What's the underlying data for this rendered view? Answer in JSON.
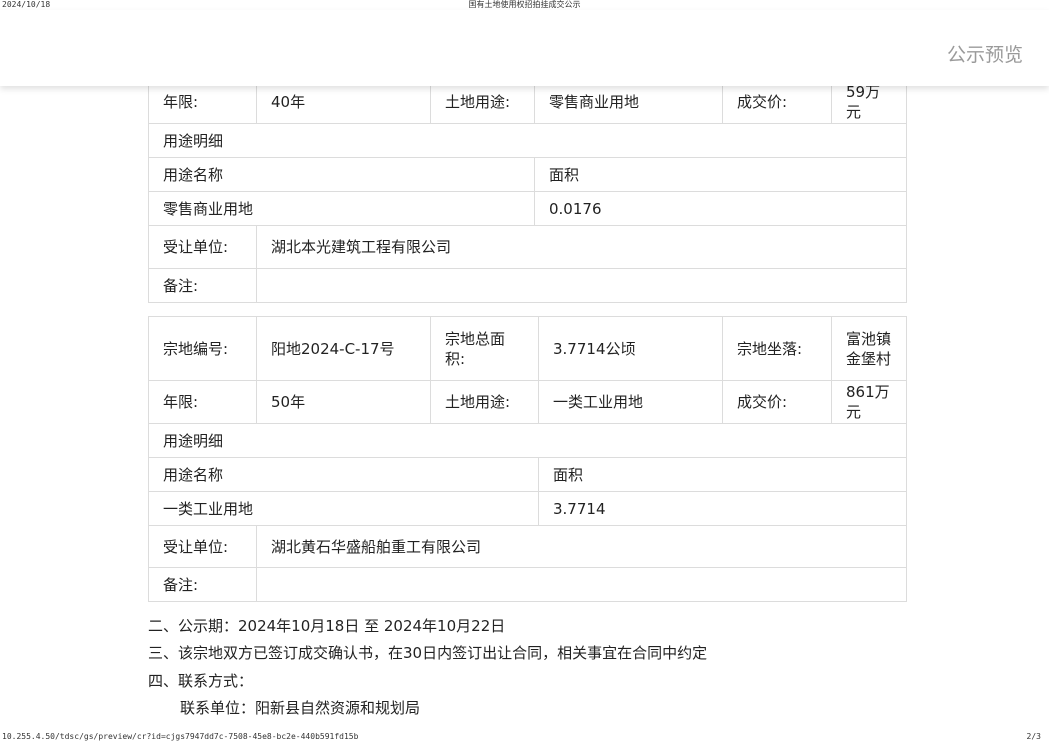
{
  "print": {
    "date": "2024/10/18",
    "title": "国有土地使用权招拍挂成交公示",
    "url": "10.255.4.50/tdsc/gs/preview/cr?id=cjgs7947dd7c-7508-45e8-bc2e-440b591fd15b",
    "page": "2/3"
  },
  "header": {
    "title": "公示预览"
  },
  "parcel1": {
    "term_label": "年限:",
    "term_value": "40年",
    "use_label": "土地用途:",
    "use_value": "零售商业用地",
    "price_label": "成交价:",
    "price_value": "59万元",
    "usage_detail_label": "用途明细",
    "usage_name_label": "用途名称",
    "area_label": "面积",
    "usage_name_value": "零售商业用地",
    "area_value": "0.0176",
    "assignee_label": "受让单位:",
    "assignee_value": "湖北本光建筑工程有限公司",
    "remark_label": "备注:",
    "remark_value": ""
  },
  "parcel2": {
    "id_label": "宗地编号:",
    "id_value": "阳地2024-C-17号",
    "total_area_label": "宗地总面积:",
    "total_area_value": "3.7714公顷",
    "location_label": "宗地坐落:",
    "location_value": "富池镇金堡村",
    "term_label": "年限:",
    "term_value": "50年",
    "use_label": "土地用途:",
    "use_value": "一类工业用地",
    "price_label": "成交价:",
    "price_value": "861万元",
    "usage_detail_label": "用途明细",
    "usage_name_label": "用途名称",
    "area_label": "面积",
    "usage_name_value": "一类工业用地",
    "area_value": "3.7714",
    "assignee_label": "受让单位:",
    "assignee_value": "湖北黄石华盛船舶重工有限公司",
    "remark_label": "备注:",
    "remark_value": ""
  },
  "footer": {
    "period": "二、公示期：2024年10月18日 至 2024年10月22日",
    "contract": "三、该宗地双方已签订成交确认书，在30日内签订出让合同，相关事宜在合同中约定",
    "contact_heading": "四、联系方式：",
    "contact_unit": "联系单位：阳新县自然资源和规划局"
  }
}
